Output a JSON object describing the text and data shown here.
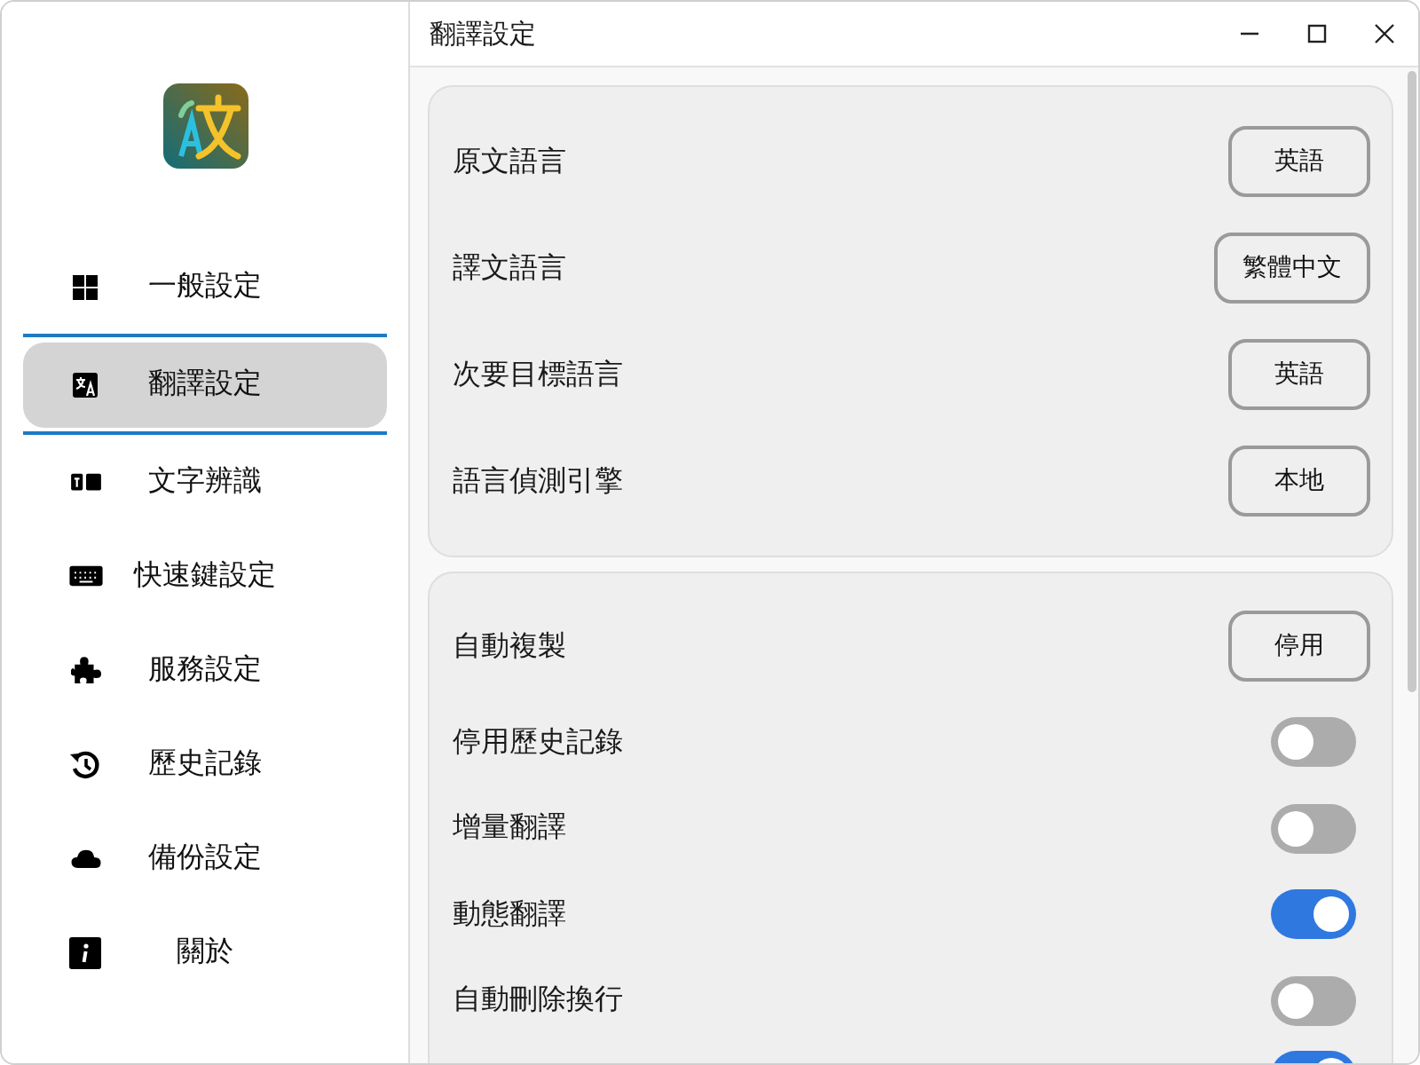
{
  "window": {
    "title": "翻譯設定"
  },
  "sidebar": {
    "items": [
      {
        "label": "一般設定",
        "selected": false
      },
      {
        "label": "翻譯設定",
        "selected": true
      },
      {
        "label": "文字辨識",
        "selected": false
      },
      {
        "label": "快速鍵設定",
        "selected": false
      },
      {
        "label": "服務設定",
        "selected": false
      },
      {
        "label": "歷史記錄",
        "selected": false
      },
      {
        "label": "備份設定",
        "selected": false
      },
      {
        "label": "關於",
        "selected": false
      }
    ]
  },
  "sections": [
    {
      "rows": [
        {
          "kind": "select",
          "label": "原文語言",
          "value": "英語"
        },
        {
          "kind": "select",
          "label": "譯文語言",
          "value": "繁體中文"
        },
        {
          "kind": "select",
          "label": "次要目標語言",
          "value": "英語"
        },
        {
          "kind": "select",
          "label": "語言偵測引擎",
          "value": "本地"
        }
      ]
    },
    {
      "rows": [
        {
          "kind": "select",
          "label": "自動複製",
          "value": "停用"
        },
        {
          "kind": "toggle",
          "label": "停用歷史記錄",
          "on": false
        },
        {
          "kind": "toggle",
          "label": "增量翻譯",
          "on": false
        },
        {
          "kind": "toggle",
          "label": "動態翻譯",
          "on": true
        },
        {
          "kind": "toggle",
          "label": "自動刪除換行",
          "on": false
        },
        {
          "kind": "toggle",
          "on": true
        }
      ]
    }
  ]
}
